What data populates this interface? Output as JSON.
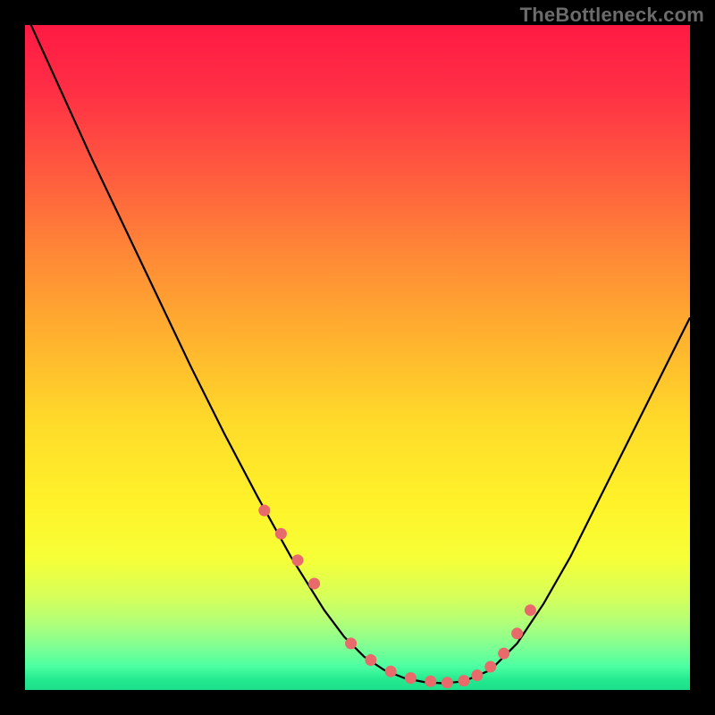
{
  "watermark": "TheBottleneck.com",
  "gradient_stops": [
    {
      "offset": 0.0,
      "color": "#ff1a44"
    },
    {
      "offset": 0.1,
      "color": "#ff2f45"
    },
    {
      "offset": 0.22,
      "color": "#ff5a3f"
    },
    {
      "offset": 0.35,
      "color": "#ff8a36"
    },
    {
      "offset": 0.48,
      "color": "#ffb52e"
    },
    {
      "offset": 0.6,
      "color": "#ffdb2a"
    },
    {
      "offset": 0.72,
      "color": "#fff22a"
    },
    {
      "offset": 0.8,
      "color": "#f7ff36"
    },
    {
      "offset": 0.86,
      "color": "#d6ff5a"
    },
    {
      "offset": 0.9,
      "color": "#b0ff7a"
    },
    {
      "offset": 0.935,
      "color": "#7fff93"
    },
    {
      "offset": 0.965,
      "color": "#4bffa2"
    },
    {
      "offset": 0.985,
      "color": "#23e98f"
    },
    {
      "offset": 1.0,
      "color": "#1ddf8a"
    }
  ],
  "chart_data": {
    "type": "line",
    "title": "",
    "xlabel": "",
    "ylabel": "",
    "xlim": [
      0,
      100
    ],
    "ylim": [
      0,
      100
    ],
    "series": [
      {
        "name": "bottleneck-curve",
        "x": [
          0,
          5,
          10,
          15,
          20,
          25,
          30,
          35,
          40,
          45,
          48,
          51,
          54,
          57,
          60,
          63,
          66,
          70,
          74,
          78,
          82,
          86,
          90,
          94,
          98,
          100
        ],
        "values": [
          102,
          91,
          80,
          69.5,
          59,
          48.5,
          38.5,
          29,
          20,
          12,
          8,
          5,
          3,
          1.8,
          1.2,
          1.0,
          1.3,
          3,
          7,
          13,
          20,
          28,
          36,
          44,
          52,
          56
        ]
      }
    ],
    "markers": {
      "name": "highlight-dots",
      "color": "#e86a6a",
      "x": [
        36,
        38.5,
        41,
        43.5,
        49,
        52,
        55,
        58,
        61,
        63.5,
        66,
        68,
        70,
        72,
        74,
        76
      ],
      "values": [
        27,
        23.5,
        19.5,
        16,
        7,
        4.5,
        2.8,
        1.8,
        1.3,
        1.1,
        1.4,
        2.2,
        3.5,
        5.5,
        8.5,
        12
      ]
    }
  }
}
